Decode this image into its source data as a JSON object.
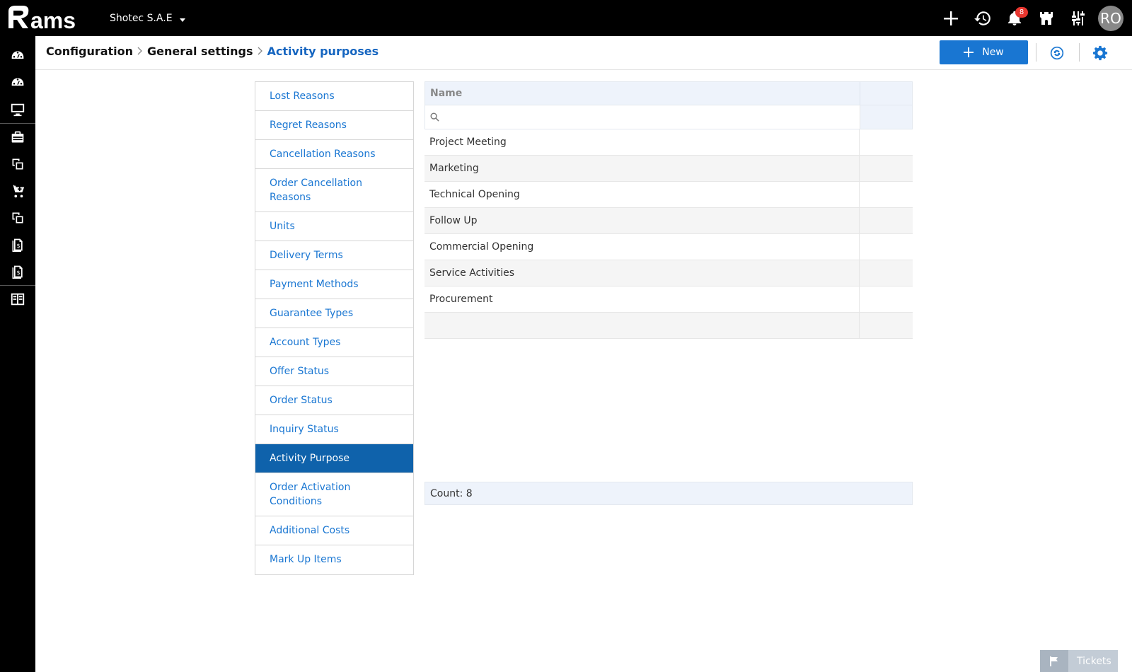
{
  "topbar": {
    "logo_text": "ams",
    "company": "Shotec S.A.E",
    "notifications_count": "8",
    "avatar_initials": "RO"
  },
  "breadcrumb": {
    "items": [
      "Configuration",
      "General settings"
    ],
    "current": "Activity purposes"
  },
  "toolbar": {
    "new_label": "New"
  },
  "settings_nav": [
    "Lost Reasons",
    "Regret Reasons",
    "Cancellation Reasons",
    "Order Cancellation Reasons",
    "Units",
    "Delivery Terms",
    "Payment Methods",
    "Guarantee Types",
    "Account Types",
    "Offer Status",
    "Order Status",
    "Inquiry Status",
    "Activity Purpose",
    "Order Activation Conditions",
    "Additional Costs",
    "Mark Up Items"
  ],
  "settings_active": "Activity Purpose",
  "grid": {
    "column_name": "Name",
    "search_placeholder": "",
    "rows": [
      "Project Meeting",
      "Marketing",
      "Technical Opening",
      "Follow Up",
      "Commercial Opening",
      "Service Activities",
      "Procurement",
      ""
    ],
    "footer": "Count: 8"
  },
  "tickets_label": "Tickets",
  "colors": {
    "accent": "#1976d2",
    "active_nav": "#0f62ab",
    "topbar": "#000000",
    "badge": "#e8362f"
  }
}
